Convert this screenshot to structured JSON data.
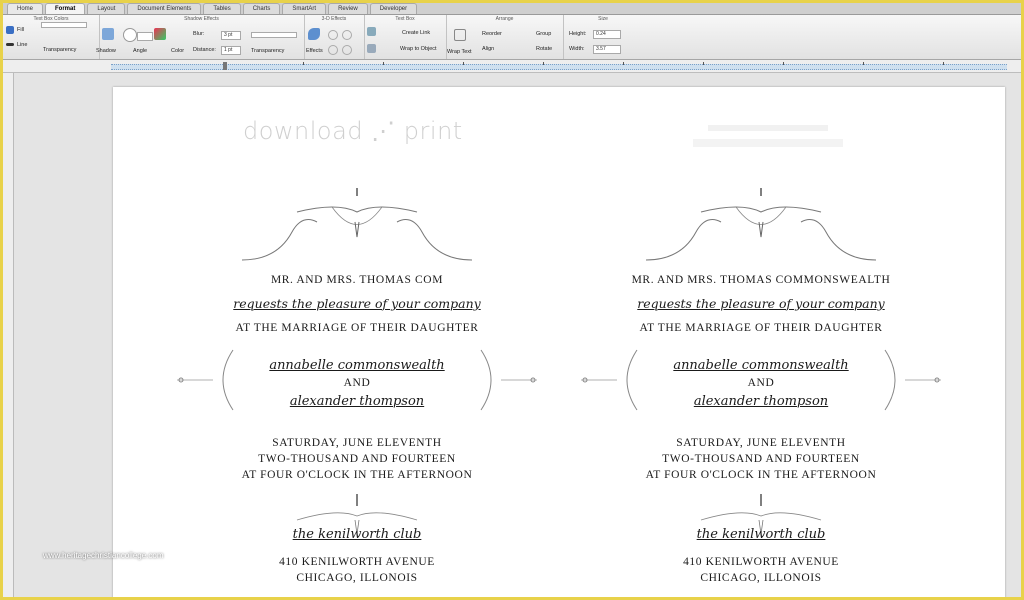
{
  "tabs": [
    {
      "label": "Home"
    },
    {
      "label": "Format"
    },
    {
      "label": "Layout"
    },
    {
      "label": "Document Elements"
    },
    {
      "label": "Tables"
    },
    {
      "label": "Charts"
    },
    {
      "label": "SmartArt"
    },
    {
      "label": "Review"
    },
    {
      "label": "Developer"
    }
  ],
  "ribbon": {
    "groups": {
      "text_box_colors": "Text Box Colors",
      "shadow_effects": "Shadow Effects",
      "effects_3d": "3-D Effects",
      "text_box": "Text Box",
      "arrange": "Arrange",
      "size": "Size"
    },
    "fill_label": "Fill",
    "line_label": "Line",
    "transparency_label": "Transparency",
    "shadow_label": "Shadow",
    "angle_label": "Angle",
    "color_label": "Color",
    "blur_label": "Blur:",
    "distance_label": "Distance:",
    "blur_value": "3 pt",
    "distance_value": "1 pt",
    "transparency2_label": "Transparency",
    "effects_label": "Effects",
    "create_link_label": "Create Link",
    "wrap_to_object_label": "Wrap to Object",
    "wrap_text_label": "Wrap Text",
    "reorder_label": "Reorder",
    "align_label": "Align",
    "group_label": "Group",
    "rotate_label": "Rotate",
    "height_label": "Height:",
    "height_value": "0.24",
    "width_label": "Width:",
    "width_value": "3.57"
  },
  "document": {
    "brand": "download ⋰ print",
    "invitations": [
      {
        "host": "MR. AND MRS. THOMAS COM",
        "requests": "requests the pleasure of your company",
        "occasion": "AT THE MARRIAGE OF THEIR DAUGHTER",
        "bride": "annabelle commonswealth",
        "and": "AND",
        "groom": "alexander thompson",
        "date1": "SATURDAY, JUNE ELEVENTH",
        "date2": "TWO-THOUSAND AND FOURTEEN",
        "time": "AT FOUR O'CLOCK IN THE AFTERNOON",
        "venue": "the kenilworth club",
        "address": "410 KENILWORTH AVENUE",
        "city": "CHICAGO, ILLONOIS"
      },
      {
        "host": "MR. AND MRS. THOMAS COMMONSWEALTH",
        "requests": "requests the pleasure of your company",
        "occasion": "AT THE MARRIAGE OF THEIR DAUGHTER",
        "bride": "annabelle commonswealth",
        "and": "AND",
        "groom": "alexander thompson",
        "date1": "SATURDAY, JUNE ELEVENTH",
        "date2": "TWO-THOUSAND AND FOURTEEN",
        "time": "AT FOUR O'CLOCK IN THE AFTERNOON",
        "venue": "the kenilworth club",
        "address": "410 KENILWORTH AVENUE",
        "city": "CHICAGO, ILLONOIS"
      }
    ],
    "watermark": "www.heritagechristiancollege.com"
  }
}
